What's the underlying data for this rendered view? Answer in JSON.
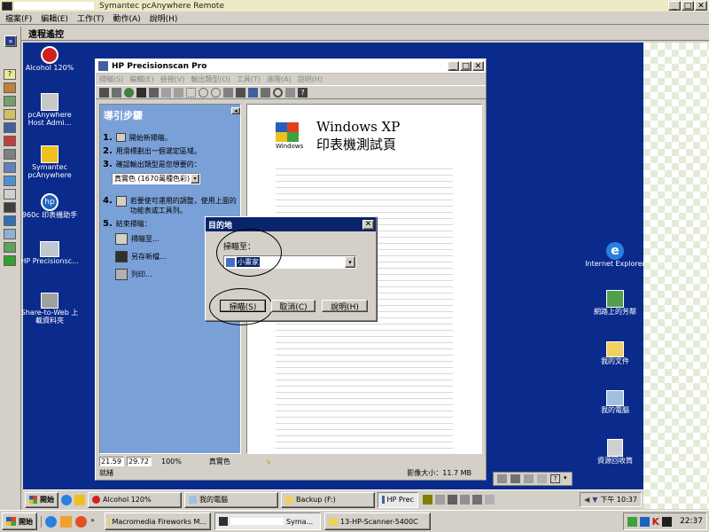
{
  "outer": {
    "title": "Symantec pcAnywhere Remote",
    "title_prefix_hidden": "██████",
    "menu": [
      "檔案(F)",
      "編輯(E)",
      "工作(T)",
      "動作(A)",
      "說明(H)"
    ],
    "remote_label": "遠程遙控",
    "colors": {
      "title_bg": "#ece9c4",
      "remote_desktop": "#0a2a8c",
      "check_a": "#ffffff",
      "check_b": "#e8f0e0"
    }
  },
  "desktop_left": [
    {
      "name": "alcohol-icon",
      "label": "Alcohol 120%"
    },
    {
      "name": "pcanywhere-host-icon",
      "label": "pcAnywhere Host Admi..."
    },
    {
      "name": "symantec-pcanywhere-icon",
      "label": "Symantec pcAnywhere"
    },
    {
      "name": "hp-960c-icon",
      "label": "960c 印表機助手"
    },
    {
      "name": "hp-precisionscan-icon",
      "label": "HP Precisionsc..."
    },
    {
      "name": "share-to-web-icon",
      "label": "Share-to-Web 上載資料夾"
    }
  ],
  "desktop_right": [
    {
      "name": "internet-explorer-icon",
      "label": "Internet Explorer"
    },
    {
      "name": "network-places-icon",
      "label": "網路上的芳鄰"
    },
    {
      "name": "my-documents-icon",
      "label": "我的文件"
    },
    {
      "name": "my-computer-icon",
      "label": "我的電腦"
    },
    {
      "name": "recycle-bin-icon",
      "label": "資源回收筒"
    }
  ],
  "hp_window": {
    "title": "HP Precisionscan Pro",
    "menu": [
      "掃瞄(S)",
      "編輯(E)",
      "檢視(V)",
      "輸出類型(O)",
      "工具(T)",
      "進階(A)",
      "說明(H)"
    ],
    "guide_title": "導引步驟",
    "steps": [
      {
        "num": "1.",
        "text": "開始新掃瞄。"
      },
      {
        "num": "2.",
        "text": "用滑標劃出一個選定區域。"
      },
      {
        "num": "3.",
        "text": "確認輸出類型是您想要的："
      }
    ],
    "output_type": "真實色 (1670萬種色彩)",
    "step4_num": "4.",
    "step4_text": "若要使可運用的調整，使用上面的功能表或工具列。",
    "step5_num": "5.",
    "step5_text": "結束掃瞄：",
    "finish_actions": [
      "掃瞄至...",
      "另存新檔...",
      "列印..."
    ],
    "status_width": "21.59",
    "status_height": "29.72",
    "status_zoom": "100%",
    "status_color": "真實色",
    "status_ready": "就緒",
    "status_size_label": "影像大小：",
    "status_size_value": "11.7 MB",
    "preview": {
      "title_line1": "Windows XP",
      "title_line2": "印表機測試頁",
      "logo": "Windows"
    }
  },
  "dialog": {
    "title": "目的地",
    "scan_to_label": "掃瞄至：",
    "selected": "小畫家",
    "scan_button": "掃瞄(S)",
    "cancel_button": "取消(C)",
    "help_button": "說明(H)"
  },
  "remote_taskbar": {
    "start": "開始",
    "tasks": [
      "Alcohol 120%",
      "我的電腦",
      "Backup (F:)",
      "HP Prec"
    ],
    "time": "下午 10:37"
  },
  "local_taskbar": {
    "start": "開始",
    "tasks": [
      "Macromedia Fireworks M...",
      "Syma...",
      "13-HP-Scanner-5400C"
    ],
    "time": "22:37"
  }
}
